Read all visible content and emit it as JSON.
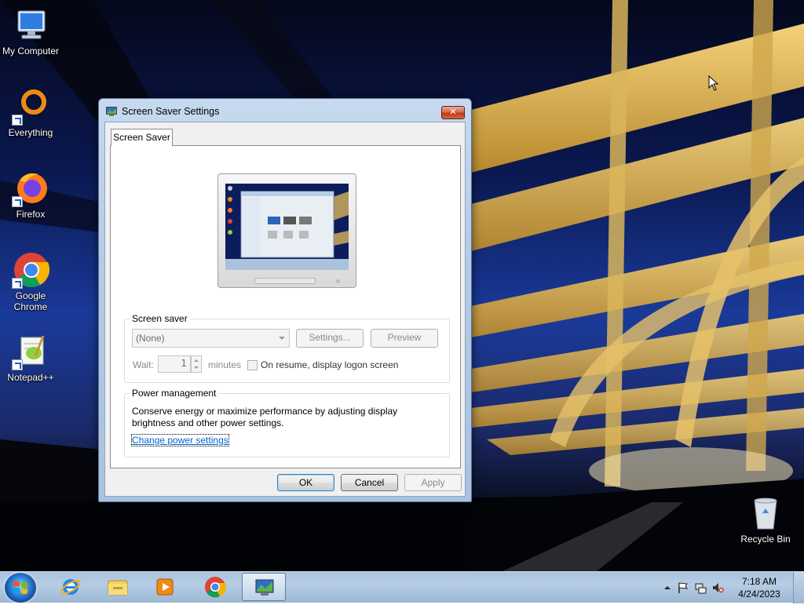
{
  "desktop": {
    "icons": [
      {
        "label": "My Computer",
        "icon": "computer-icon"
      },
      {
        "label": "Everything",
        "icon": "everything-search-icon"
      },
      {
        "label": "Firefox",
        "icon": "firefox-icon"
      },
      {
        "label": "Google Chrome",
        "icon": "chrome-icon"
      },
      {
        "label": "Notepad++",
        "icon": "notepadpp-icon"
      },
      {
        "label": "Recycle Bin",
        "icon": "recycle-bin-icon"
      }
    ]
  },
  "dialog": {
    "title": "Screen Saver Settings",
    "close_label": "✕",
    "tab": "Screen Saver",
    "screensaver": {
      "group_label": "Screen saver",
      "selected": "(None)",
      "settings_label": "Settings...",
      "preview_label": "Preview",
      "wait_label": "Wait:",
      "wait_value": "1",
      "minutes_label": "minutes",
      "resume_label": "On resume, display logon screen",
      "resume_checked": false
    },
    "power": {
      "group_label": "Power management",
      "description": "Conserve energy or maximize performance by adjusting display brightness and other power settings.",
      "link_label": "Change power settings"
    },
    "buttons": {
      "ok": "OK",
      "cancel": "Cancel",
      "apply": "Apply"
    }
  },
  "taskbar": {
    "pinned": [
      "internet-explorer-icon",
      "file-explorer-icon",
      "media-player-icon",
      "chrome-icon",
      "screen-saver-settings-icon"
    ],
    "active": "screen-saver-settings-icon",
    "clock_time": "7:18 AM",
    "clock_date": "4/24/2023"
  },
  "colors": {
    "titlebar": "#b4cbe6",
    "close_button": "#c1391b",
    "link": "#0066cc",
    "taskbar": "#a9c3de"
  }
}
